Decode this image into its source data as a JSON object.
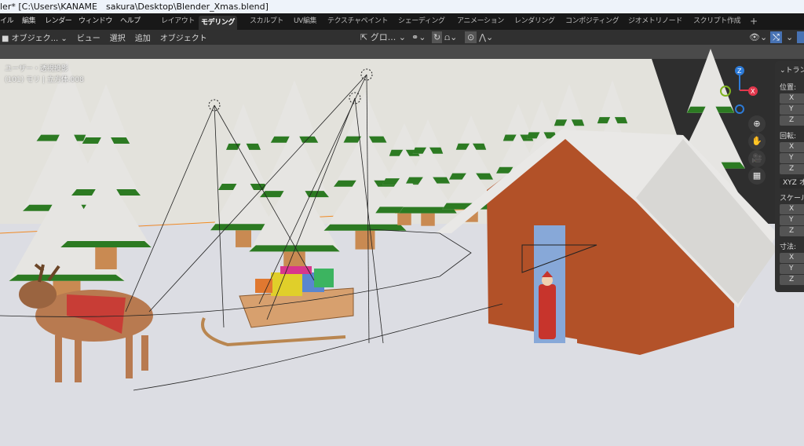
{
  "window": {
    "title": "ler* [C:\\Users\\KANAME　sakura\\Desktop\\Blender_Xmas.blend]"
  },
  "menu": {
    "items": [
      "イル",
      "編集",
      "レンダー",
      "ウィンドウ",
      "ヘルプ"
    ]
  },
  "workspaces": {
    "tabs": [
      "レイアウト",
      "モデリング",
      "スカルプト",
      "UV編集",
      "テクスチャペイント",
      "シェーディング",
      "アニメーション",
      "レンダリング",
      "コンポジティング",
      "ジオメトリノード",
      "スクリプト作成"
    ],
    "active": "モデリング",
    "add": "+"
  },
  "header": {
    "mode": "オブジェク...",
    "items": [
      "ビュー",
      "選択",
      "追加",
      "オブジェクト"
    ],
    "transform_orientation": "グロ...",
    "accent": "#4772b3"
  },
  "viewport": {
    "view_name": "ユーザー・透視投影",
    "object_info": "(101) モリ | 立方体.008"
  },
  "gizmo": {
    "x": "X",
    "y": "Y",
    "z": "Z",
    "x_color": "#e2374c",
    "y_color": "#7fb31f",
    "z_color": "#2d7bd8"
  },
  "npanel": {
    "title": "トラン",
    "location": "位置:",
    "rotation": "回転:",
    "rotation_mode": "XYZ オ",
    "scale": "スケール",
    "dimensions": "寸法:",
    "axes": [
      "X",
      "Y",
      "Z"
    ]
  }
}
